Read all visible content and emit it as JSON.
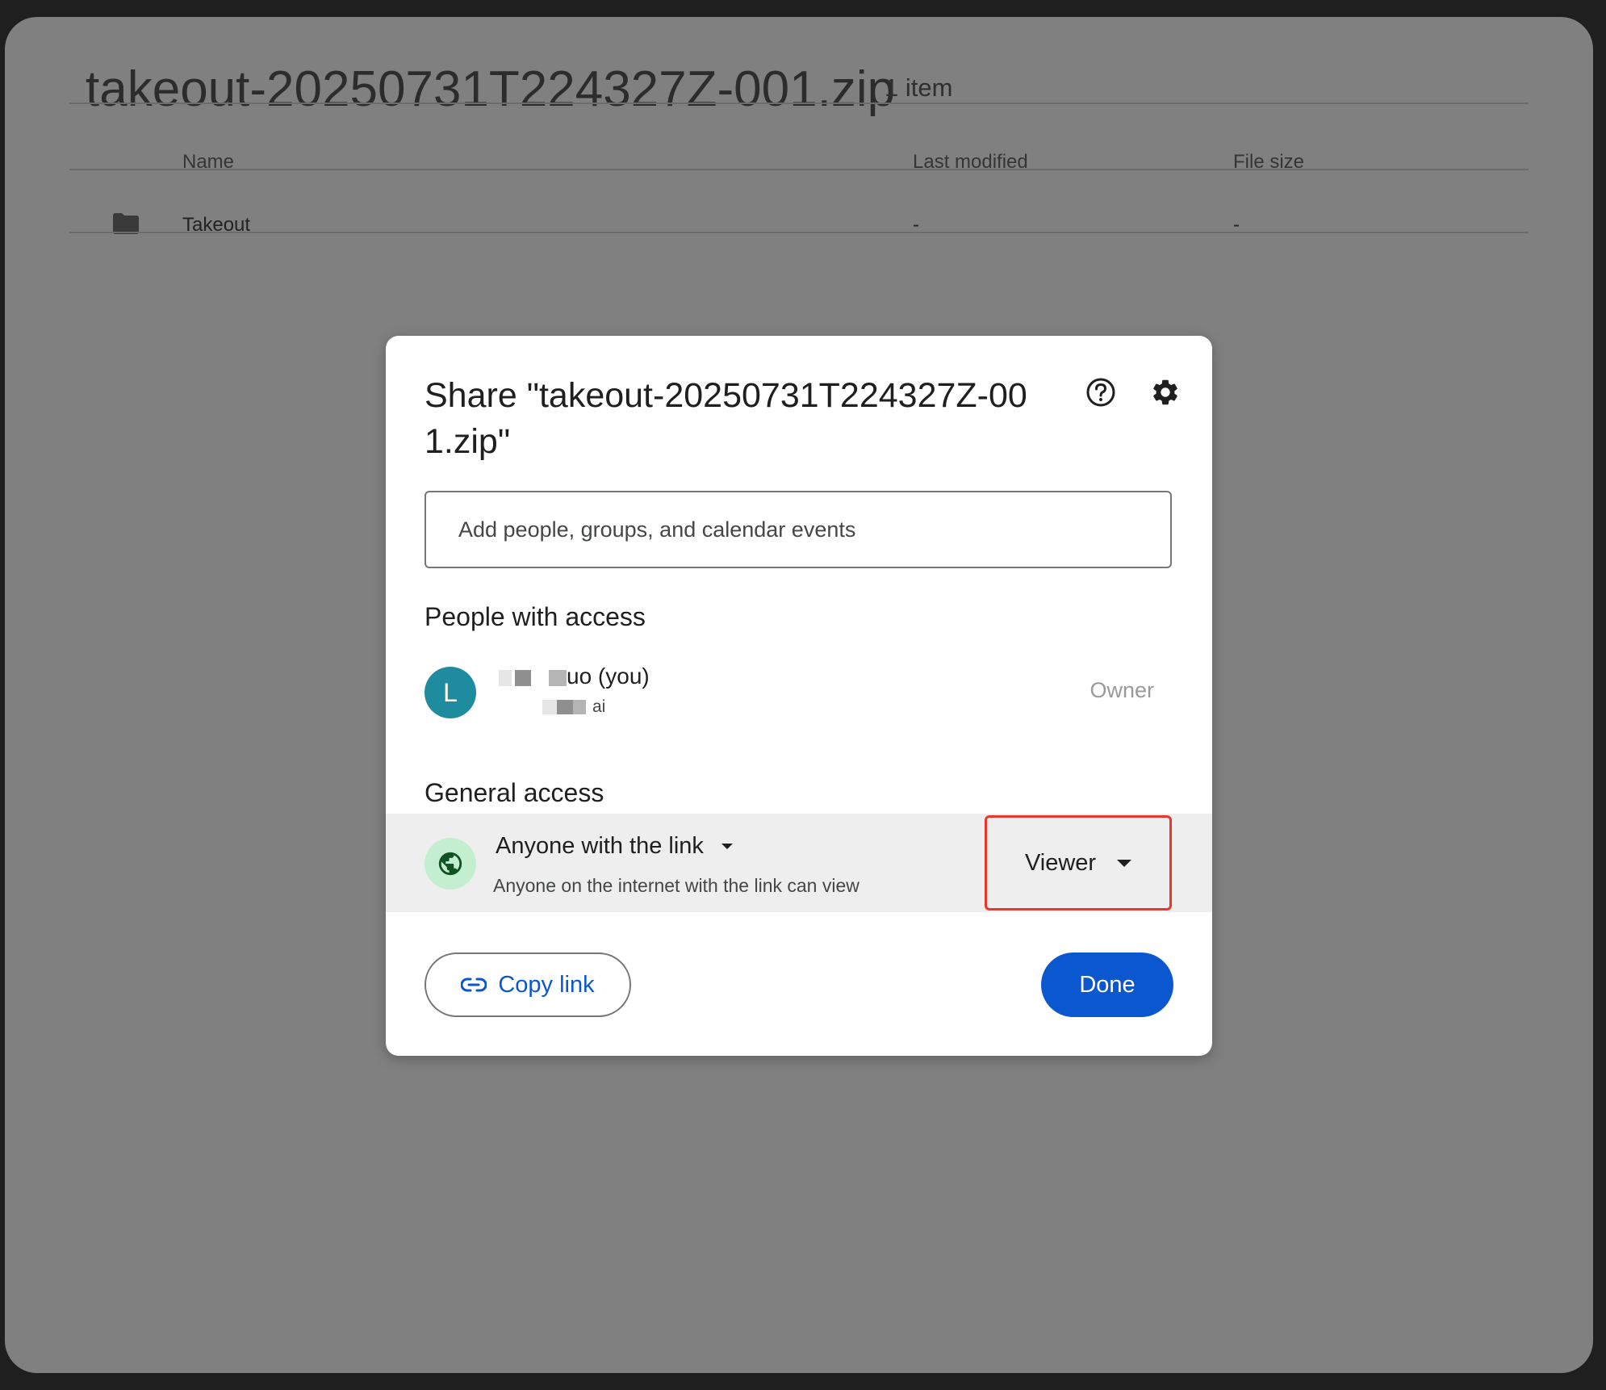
{
  "background": {
    "archive_title": "takeout-20250731T224327Z-001.zip",
    "item_count": "1 item",
    "columns": {
      "name": "Name",
      "last_modified": "Last modified",
      "file_size": "File size"
    },
    "rows": [
      {
        "name": "Takeout",
        "last_modified": "-",
        "file_size": "-",
        "icon": "folder-icon"
      }
    ]
  },
  "dialog": {
    "title": "Share \"takeout-20250731T224327Z-001.zip\"",
    "help_icon": "help-icon",
    "settings_icon": "settings-icon",
    "add_people_placeholder": "Add people, groups, and calendar events",
    "people_section_title": "People with access",
    "person": {
      "avatar_letter": "L",
      "name_visible_suffix": "uo (you)",
      "email_visible_suffix": "ai",
      "role": "Owner"
    },
    "general_section_title": "General access",
    "general_access": {
      "type": "Anyone with the link",
      "description": "Anyone on the internet with the link can view",
      "role": "Viewer",
      "icon": "globe-icon"
    },
    "copy_link_label": "Copy link",
    "done_label": "Done"
  },
  "colors": {
    "primary": "#0b57d0",
    "avatar": "#1e8b9e",
    "globe_bg": "#c4eed0",
    "highlight_border": "#e8372b"
  }
}
